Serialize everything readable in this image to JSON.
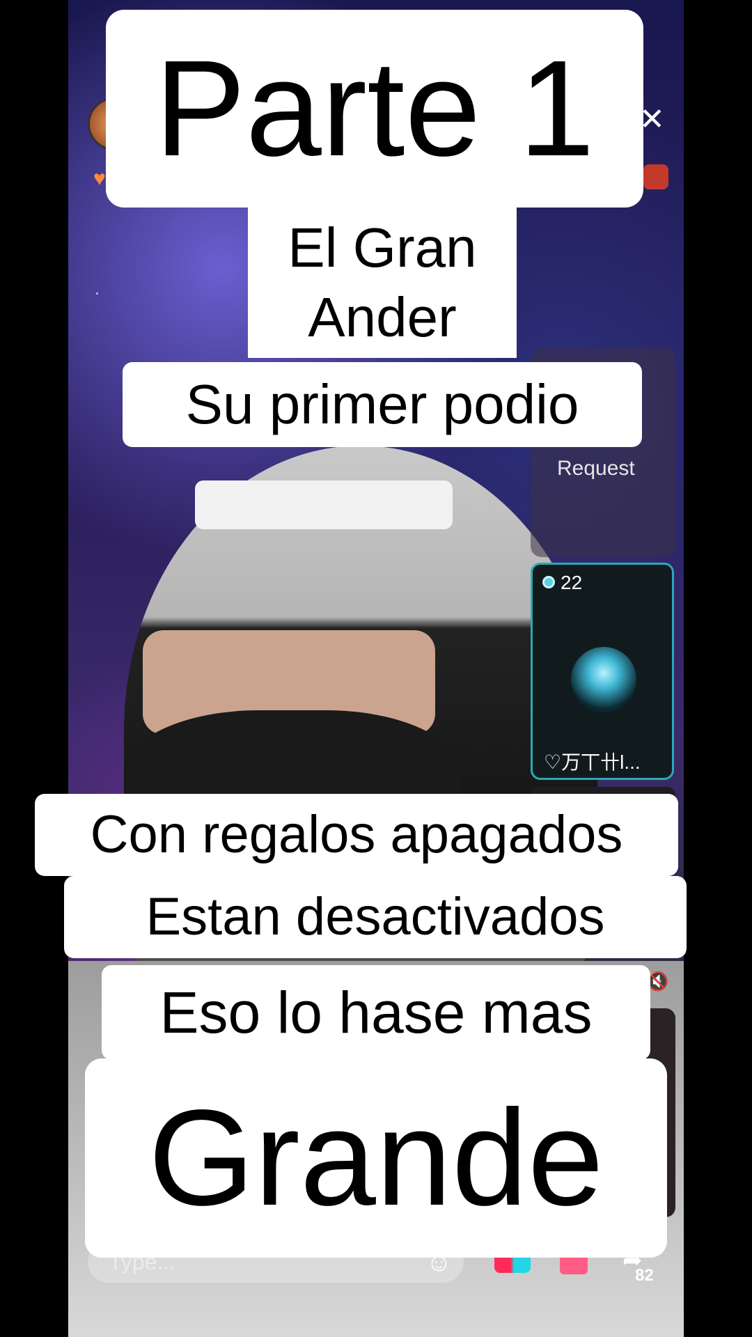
{
  "live": {
    "request_label": "Request",
    "guest": {
      "count": "22",
      "name": "♡万丅卄l..."
    },
    "comment_placeholder": "Type...",
    "share_count": "82"
  },
  "captions": {
    "line1": "Parte 1",
    "line2a": "El Gran",
    "line2b": "Ander",
    "line3": "Su primer podio",
    "line4": "Con regalos apagados",
    "line5": "Estan desactivados",
    "line6": "Eso lo hase mas",
    "line7": "Grande"
  },
  "icons": {
    "close": "close-icon",
    "emoji": "emoji-icon",
    "gift": "gift-icon",
    "share": "share-icon",
    "mic": "mic-muted-icon"
  },
  "colors": {
    "guest_border": "#2aa9b8",
    "caption_bg": "#ffffff",
    "caption_text": "#000000"
  }
}
